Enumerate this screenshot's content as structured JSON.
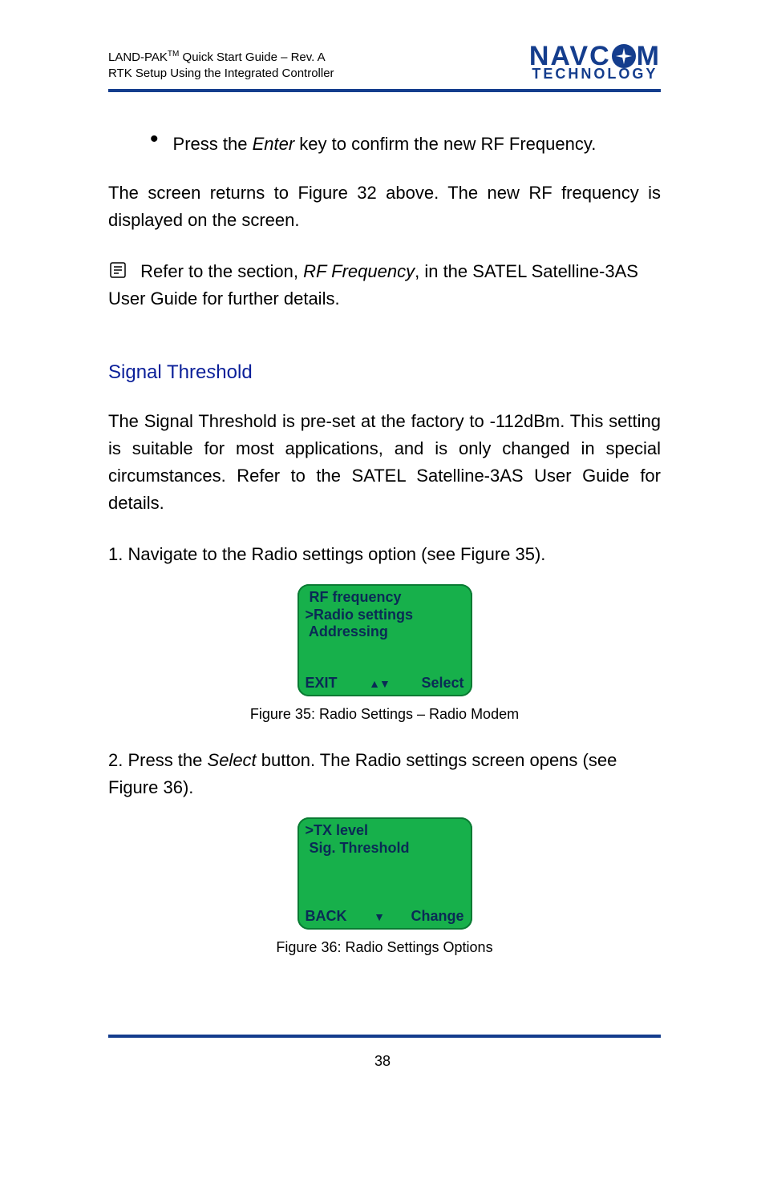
{
  "header": {
    "doc_title_line1": "LAND-PAK™ Quick Start Guide – Rev. A",
    "doc_title_line2": "RTK Setup Using the Integrated Controller",
    "logo_top_left": "NAVC",
    "logo_top_right": "M",
    "logo_bottom": "TECHNOLOGY"
  },
  "body": {
    "bullet1_a": "Press the ",
    "bullet1_enter": "Enter",
    "bullet1_b": " key to confirm the new RF Frequency.",
    "para1": "The screen returns to Figure 32 above. The new RF frequency is displayed on the screen.",
    "note_a": "Refer to the section, ",
    "note_em": "RF Frequency",
    "note_b": ", in the SATEL Satelline-3AS User Guide for further details.",
    "section": "Signal Threshold",
    "para2": "The Signal Threshold is pre-set at the factory to -112dBm. This setting is suitable for most applications, and is only changed in special circumstances. Refer to the SATEL Satelline-3AS User Guide for details.",
    "step1": "1. Navigate to the Radio settings option (see Figure 35).",
    "fig35": "Figure 35: Radio Settings – Radio Modem",
    "step2_a": "2. Press the ",
    "step2_btn": "Select",
    "step2_b": " button. The Radio settings screen opens (see Figure 36).",
    "fig36": "Figure 36: Radio Settings Options"
  },
  "screen1": {
    "l1": " RF frequency",
    "l2": ">Radio settings",
    "l3": " Addressing",
    "left": "EXIT",
    "mid": "▲▼",
    "right": "Select"
  },
  "screen2": {
    "l1": ">TX level",
    "l2": " Sig. Threshold",
    "left": "BACK",
    "mid": "▼",
    "right": "Change"
  },
  "page_number": "38"
}
